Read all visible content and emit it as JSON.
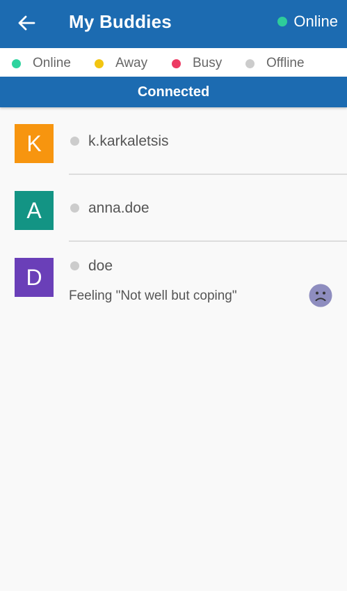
{
  "appbar": {
    "title": "My Buddies",
    "status_label": "Online",
    "status_color": "#2ecc9a",
    "background": "#1c6bb1"
  },
  "legend": [
    {
      "label": "Online",
      "color": "#2ed39e"
    },
    {
      "label": "Away",
      "color": "#f2c511"
    },
    {
      "label": "Busy",
      "color": "#ec3a63"
    },
    {
      "label": "Offline",
      "color": "#cccccc"
    }
  ],
  "connection": {
    "label": "Connected"
  },
  "buddies": [
    {
      "initial": "K",
      "name": "k.karkaletsis",
      "avatar_color": "#f7950f",
      "status_color": "#cccccc"
    },
    {
      "initial": "A",
      "name": "anna.doe",
      "avatar_color": "#139484",
      "status_color": "#cccccc"
    },
    {
      "initial": "D",
      "name": "doe",
      "avatar_color": "#6a3fb8",
      "status_color": "#cccccc",
      "mood": "Feeling \"Not well but coping\"",
      "mood_icon": "sad-face-icon"
    }
  ]
}
